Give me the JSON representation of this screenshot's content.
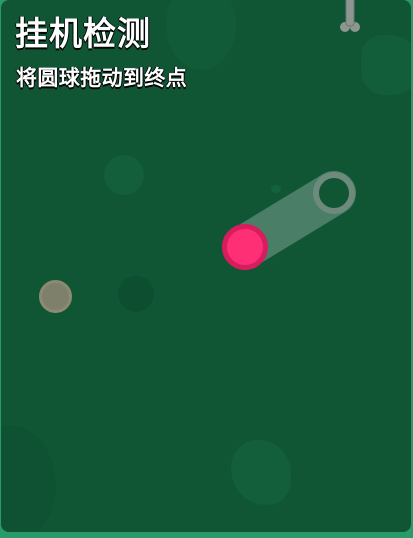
{
  "captcha": {
    "title": "挂机检测",
    "instruction": "将圆球拖动到终点"
  },
  "colors": {
    "frame": "#2a9a68",
    "panel": "#105635",
    "ball": "#ff2f76",
    "ball_border": "#d81d5f",
    "track": "#5f8c78",
    "target_ring": "#6e8a7d",
    "dummy_dot": "#7e806b"
  },
  "icons": {
    "top": "bone-icon"
  }
}
